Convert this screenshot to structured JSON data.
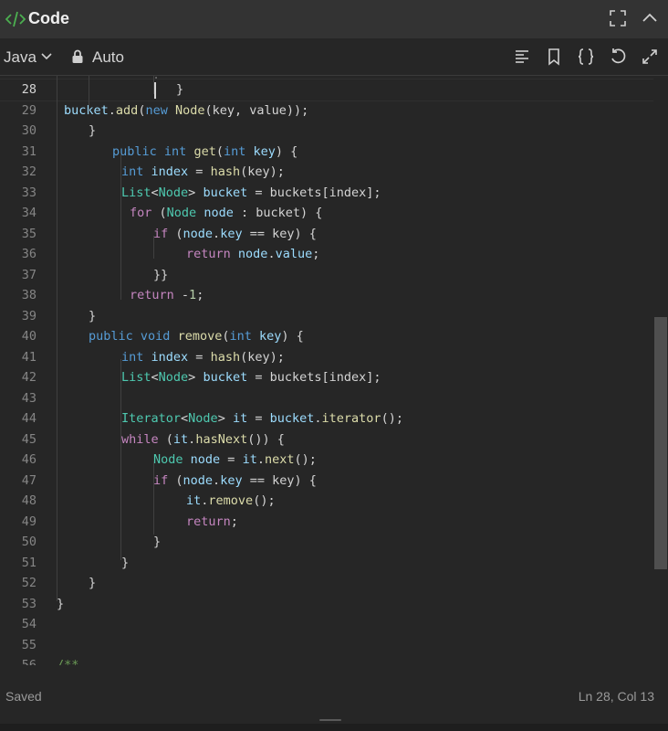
{
  "header": {
    "title": "Code"
  },
  "toolbar": {
    "language": "Java",
    "mode": "Auto"
  },
  "editor": {
    "current_line": "28",
    "lines": [
      {
        "n": "28",
        "html": "<span>}</span>"
      },
      {
        "n": "29",
        "html": "<span class=\"vr\">bucket</span>.<span class=\"fn\">add</span>(<span class=\"kt\">new</span> <span class=\"fn\">Node</span>(key, value));"
      },
      {
        "n": "30",
        "html": "}"
      },
      {
        "n": "31",
        "html": "<span class=\"kt\">public</span> <span class=\"kt\">int</span> <span class=\"fn\">get</span>(<span class=\"kt\">int</span> <span class=\"vr\">key</span>) {"
      },
      {
        "n": "32",
        "html": "<span class=\"kt\">int</span> <span class=\"vr\">index</span> = <span class=\"fn\">hash</span>(key);"
      },
      {
        "n": "33",
        "html": "<span class=\"ty\">List</span>&lt;<span class=\"ty\">Node</span>&gt; <span class=\"vr\">bucket</span> = buckets[index];"
      },
      {
        "n": "34",
        "html": "<span class=\"kw\">for</span> (<span class=\"ty\">Node</span> <span class=\"vr\">node</span> : bucket) {"
      },
      {
        "n": "35",
        "html": "<span class=\"kw\">if</span> (<span class=\"vr\">node</span>.<span class=\"vr\">key</span> == key) {"
      },
      {
        "n": "36",
        "html": "<span class=\"kw\">return</span> <span class=\"vr\">node</span>.<span class=\"vr\">value</span>;"
      },
      {
        "n": "37",
        "html": "}}"
      },
      {
        "n": "38",
        "html": "<span class=\"kw\">return</span> -<span class=\"nm\">1</span>;"
      },
      {
        "n": "39",
        "html": "}"
      },
      {
        "n": "40",
        "html": "<span class=\"kt\">public</span> <span class=\"kt\">void</span> <span class=\"fn\">remove</span>(<span class=\"kt\">int</span> <span class=\"vr\">key</span>) {"
      },
      {
        "n": "41",
        "html": "<span class=\"kt\">int</span> <span class=\"vr\">index</span> = <span class=\"fn\">hash</span>(key);"
      },
      {
        "n": "42",
        "html": "<span class=\"ty\">List</span>&lt;<span class=\"ty\">Node</span>&gt; <span class=\"vr\">bucket</span> = buckets[index];"
      },
      {
        "n": "43",
        "html": ""
      },
      {
        "n": "44",
        "html": "<span class=\"ty\">Iterator</span>&lt;<span class=\"ty\">Node</span>&gt; <span class=\"vr\">it</span> = <span class=\"vr\">bucket</span>.<span class=\"fn\">iterator</span>();"
      },
      {
        "n": "45",
        "html": "<span class=\"kw\">while</span> (<span class=\"vr\">it</span>.<span class=\"fn\">hasNext</span>()) {"
      },
      {
        "n": "46",
        "html": "<span class=\"ty\">Node</span> <span class=\"vr\">node</span> = <span class=\"vr\">it</span>.<span class=\"fn\">next</span>();"
      },
      {
        "n": "47",
        "html": "<span class=\"kw\">if</span> (<span class=\"vr\">node</span>.<span class=\"vr\">key</span> == key) {"
      },
      {
        "n": "48",
        "html": "<span class=\"vr\">it</span>.<span class=\"fn\">remove</span>();"
      },
      {
        "n": "49",
        "html": "<span class=\"kw\">return</span>;"
      },
      {
        "n": "50",
        "html": "}"
      },
      {
        "n": "51",
        "html": "}"
      },
      {
        "n": "52",
        "html": "}"
      },
      {
        "n": "53",
        "html": "}"
      },
      {
        "n": "54",
        "html": ""
      },
      {
        "n": "55",
        "html": ""
      },
      {
        "n": "56",
        "html": "<span class=\"cm\">/**</span>"
      }
    ]
  },
  "status": {
    "saved": "Saved",
    "position": "Ln 28, Col 13"
  },
  "colors": {
    "code_icon": "#4caf50",
    "background": "#262626",
    "titlebar": "#333333"
  }
}
